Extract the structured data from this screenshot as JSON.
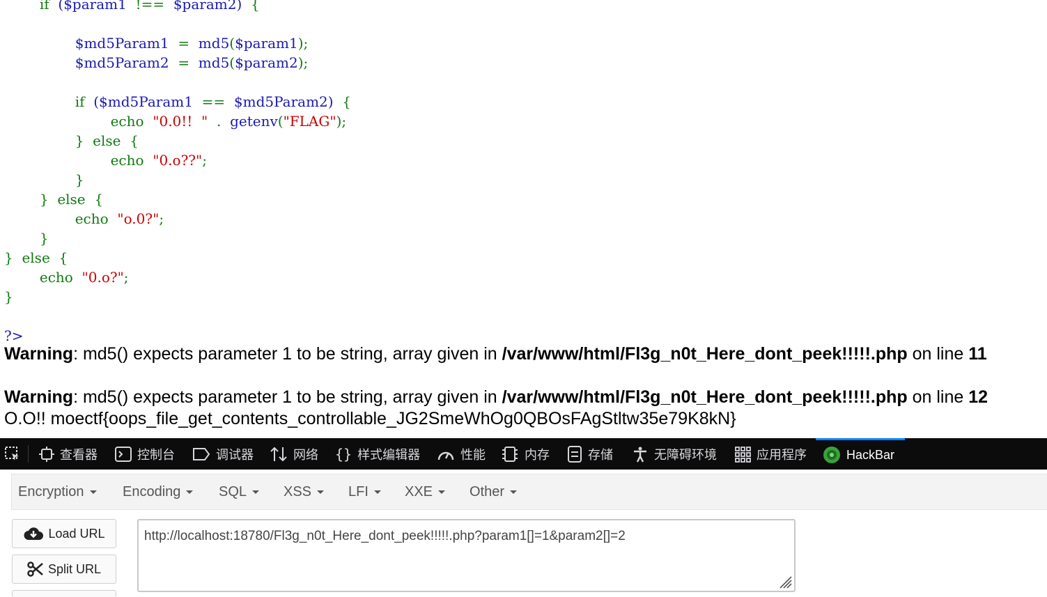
{
  "code": {
    "lines": [
      {
        "indent": "        ",
        "tokens": [
          {
            "t": "if",
            "c": "green"
          },
          {
            "t": "  ",
            "c": "blue"
          },
          {
            "t": "($param1",
            "c": "blue"
          },
          {
            "t": "  ",
            "c": "blue"
          },
          {
            "t": "!==",
            "c": "green"
          },
          {
            "t": "  ",
            "c": "blue"
          },
          {
            "t": "$param2)",
            "c": "blue"
          },
          {
            "t": "  ",
            "c": "blue"
          },
          {
            "t": "{",
            "c": "green"
          }
        ]
      },
      {
        "indent": "",
        "tokens": []
      },
      {
        "indent": "                ",
        "tokens": [
          {
            "t": "$md5Param1",
            "c": "blue"
          },
          {
            "t": "  ",
            "c": "blue"
          },
          {
            "t": "=",
            "c": "green"
          },
          {
            "t": "  ",
            "c": "blue"
          },
          {
            "t": "md5",
            "c": "blue"
          },
          {
            "t": "(",
            "c": "green"
          },
          {
            "t": "$param1",
            "c": "blue"
          },
          {
            "t": ");",
            "c": "green"
          }
        ]
      },
      {
        "indent": "                ",
        "tokens": [
          {
            "t": "$md5Param2",
            "c": "blue"
          },
          {
            "t": "  ",
            "c": "blue"
          },
          {
            "t": "=",
            "c": "green"
          },
          {
            "t": "  ",
            "c": "blue"
          },
          {
            "t": "md5",
            "c": "blue"
          },
          {
            "t": "(",
            "c": "green"
          },
          {
            "t": "$param2",
            "c": "blue"
          },
          {
            "t": ");",
            "c": "green"
          }
        ]
      },
      {
        "indent": "",
        "tokens": []
      },
      {
        "indent": "                ",
        "tokens": [
          {
            "t": "if",
            "c": "green"
          },
          {
            "t": "  ",
            "c": "blue"
          },
          {
            "t": "($md5Param1",
            "c": "blue"
          },
          {
            "t": "  ",
            "c": "blue"
          },
          {
            "t": "==",
            "c": "green"
          },
          {
            "t": "  ",
            "c": "blue"
          },
          {
            "t": "$md5Param2)",
            "c": "blue"
          },
          {
            "t": "  ",
            "c": "blue"
          },
          {
            "t": "{",
            "c": "green"
          }
        ]
      },
      {
        "indent": "                        ",
        "tokens": [
          {
            "t": "echo",
            "c": "green"
          },
          {
            "t": "  ",
            "c": "blue"
          },
          {
            "t": "\"0.0!!  \"",
            "c": "red"
          },
          {
            "t": "  ",
            "c": "blue"
          },
          {
            "t": ".",
            "c": "green"
          },
          {
            "t": "  ",
            "c": "blue"
          },
          {
            "t": "getenv",
            "c": "blue"
          },
          {
            "t": "(",
            "c": "green"
          },
          {
            "t": "\"FLAG\"",
            "c": "red"
          },
          {
            "t": ");",
            "c": "green"
          }
        ]
      },
      {
        "indent": "                ",
        "tokens": [
          {
            "t": "}",
            "c": "green"
          },
          {
            "t": "  ",
            "c": "blue"
          },
          {
            "t": "else",
            "c": "green"
          },
          {
            "t": "  ",
            "c": "blue"
          },
          {
            "t": "{",
            "c": "green"
          }
        ]
      },
      {
        "indent": "                        ",
        "tokens": [
          {
            "t": "echo",
            "c": "green"
          },
          {
            "t": "  ",
            "c": "blue"
          },
          {
            "t": "\"0.o??\"",
            "c": "red"
          },
          {
            "t": ";",
            "c": "green"
          }
        ]
      },
      {
        "indent": "                ",
        "tokens": [
          {
            "t": "}",
            "c": "green"
          }
        ]
      },
      {
        "indent": "        ",
        "tokens": [
          {
            "t": "}",
            "c": "green"
          },
          {
            "t": "  ",
            "c": "blue"
          },
          {
            "t": "else",
            "c": "green"
          },
          {
            "t": "  ",
            "c": "blue"
          },
          {
            "t": "{",
            "c": "green"
          }
        ]
      },
      {
        "indent": "                ",
        "tokens": [
          {
            "t": "echo",
            "c": "green"
          },
          {
            "t": "  ",
            "c": "blue"
          },
          {
            "t": "\"o.0?\"",
            "c": "red"
          },
          {
            "t": ";",
            "c": "green"
          }
        ]
      },
      {
        "indent": "        ",
        "tokens": [
          {
            "t": "}",
            "c": "green"
          }
        ]
      },
      {
        "indent": "",
        "tokens": [
          {
            "t": "}",
            "c": "green"
          },
          {
            "t": "  ",
            "c": "blue"
          },
          {
            "t": "else",
            "c": "green"
          },
          {
            "t": "  ",
            "c": "blue"
          },
          {
            "t": "{",
            "c": "green"
          }
        ]
      },
      {
        "indent": "        ",
        "tokens": [
          {
            "t": "echo",
            "c": "green"
          },
          {
            "t": "  ",
            "c": "blue"
          },
          {
            "t": "\"0.o?\"",
            "c": "red"
          },
          {
            "t": ";",
            "c": "green"
          }
        ]
      },
      {
        "indent": "",
        "tokens": [
          {
            "t": "}",
            "c": "green"
          }
        ]
      },
      {
        "indent": "",
        "tokens": []
      },
      {
        "indent": "",
        "tokens": [
          {
            "t": "?>",
            "c": "blue"
          }
        ]
      }
    ]
  },
  "warnings": [
    {
      "label": "Warning",
      "text": ": md5() expects parameter 1 to be string, array given in ",
      "file": "/var/www/html/Fl3g_n0t_Here_dont_peek!!!!!.php",
      "on_line": " on line ",
      "line_no": "11"
    },
    {
      "label": "Warning",
      "text": ": md5() expects parameter 1 to be string, array given in ",
      "file": "/var/www/html/Fl3g_n0t_Here_dont_peek!!!!!.php",
      "on_line": " on line ",
      "line_no": "12"
    }
  ],
  "flag_output": "O.O!! moectf{oops_file_get_contents_controllable_JG2SmeWhOg0QBOsFAgStltw35e79K8kN}",
  "devtools": {
    "tabs": [
      {
        "label": "查看器",
        "icon": "inspector-icon"
      },
      {
        "label": "控制台",
        "icon": "console-icon"
      },
      {
        "label": "调试器",
        "icon": "debugger-icon"
      },
      {
        "label": "网络",
        "icon": "network-icon"
      },
      {
        "label": "样式编辑器",
        "icon": "style-editor-icon"
      },
      {
        "label": "性能",
        "icon": "performance-icon"
      },
      {
        "label": "内存",
        "icon": "memory-icon"
      },
      {
        "label": "存储",
        "icon": "storage-icon"
      },
      {
        "label": "无障碍环境",
        "icon": "accessibility-icon"
      },
      {
        "label": "应用程序",
        "icon": "application-icon"
      },
      {
        "label": "HackBar",
        "icon": "hackbar-icon"
      }
    ],
    "active_tab": "HackBar",
    "colors": {
      "bg": "#0c0c0d",
      "active": "#0a84ff",
      "text": "#d7d7db"
    }
  },
  "hackbar": {
    "menu": [
      "Encryption",
      "Encoding",
      "SQL",
      "XSS",
      "LFI",
      "XXE",
      "Other"
    ],
    "load_url_label": "Load URL",
    "split_url_label": "Split URL",
    "url_value": "http://localhost:18780/Fl3g_n0t_Here_dont_peek!!!!!.php?param1[]=1&param2[]=2"
  },
  "colors": {
    "keyword": "#117a11",
    "variable": "#1a1ab3",
    "string": "#cc0000"
  }
}
